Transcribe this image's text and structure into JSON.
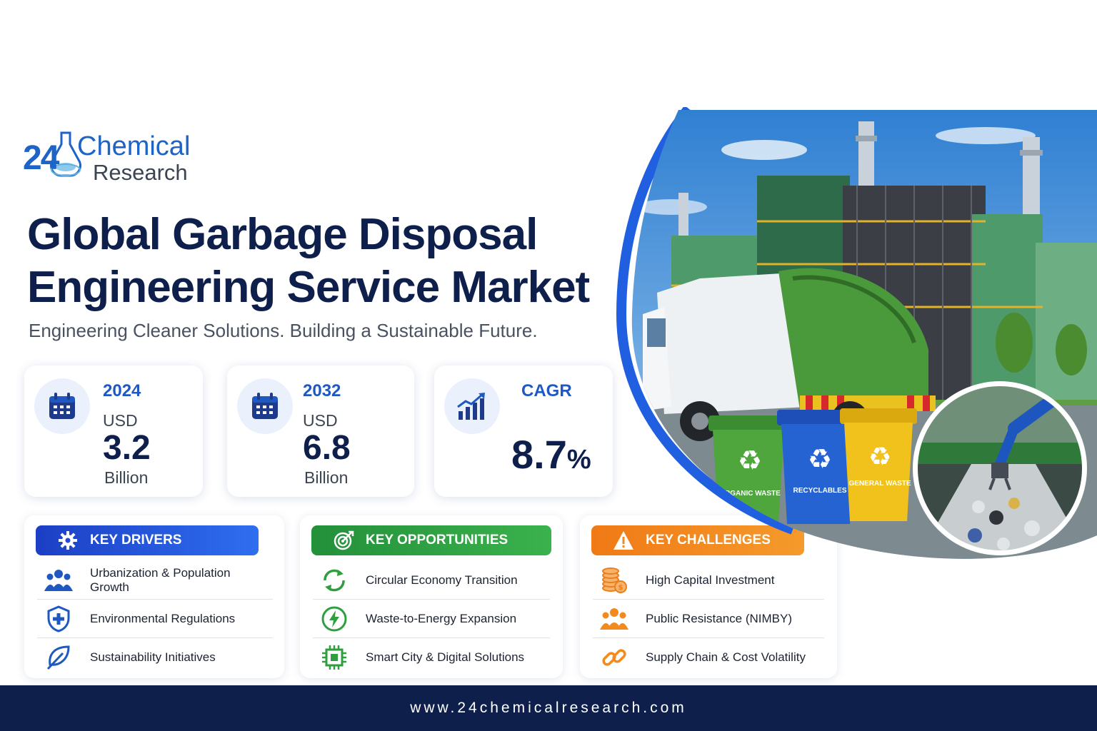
{
  "logo": {
    "number": "24",
    "line1": "Chemical",
    "line2": "Research"
  },
  "title": {
    "line1": "Global Garbage Disposal",
    "line2": "Engineering Service Market"
  },
  "subtitle": "Engineering Cleaner Solutions. Building a Sustainable Future.",
  "stats": [
    {
      "year": "2024",
      "currency": "USD",
      "value": "3.2",
      "unit": "Billion",
      "icon": "calendar-icon"
    },
    {
      "year": "2032",
      "currency": "USD",
      "value": "6.8",
      "unit": "Billion",
      "icon": "calendar-icon"
    },
    {
      "label": "CAGR",
      "value": "8.7",
      "suffix": "%",
      "icon": "growth-chart-icon"
    }
  ],
  "panels": {
    "drivers": {
      "title": "KEY DRIVERS",
      "color": "#1f4fd8",
      "items": [
        "Urbanization & Population Growth",
        "Environmental Regulations",
        "Sustainability Initiatives"
      ]
    },
    "opportunities": {
      "title": "KEY OPPORTUNITIES",
      "color": "#2e9e3e",
      "items": [
        "Circular Economy Transition",
        "Waste-to-Energy Expansion",
        "Smart City & Digital Solutions"
      ]
    },
    "challenges": {
      "title": "KEY CHALLENGES",
      "color": "#f28a1e",
      "items": [
        "High Capital Investment",
        "Public Resistance (NIMBY)",
        "Supply Chain & Cost Volatility"
      ]
    }
  },
  "bins": {
    "green": "ORGANIC WASTE",
    "blue": "RECYCLABLES",
    "yellow": "GENERAL WASTE"
  },
  "footer": {
    "url": "www.24chemicalresearch.com"
  }
}
